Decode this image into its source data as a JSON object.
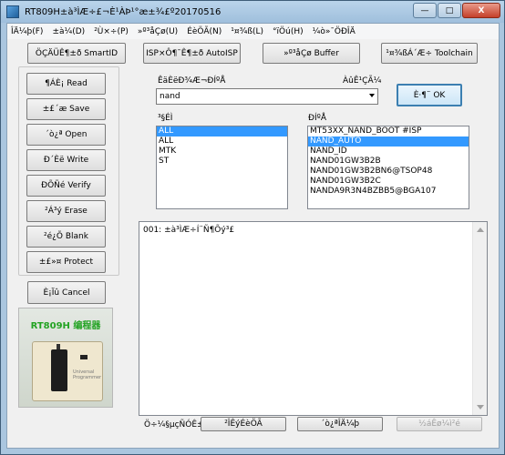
{
  "window": {
    "title": "RT809H±à³ÌÆ÷£¬È¹ÀÞ¹°æ±¾£º20170516",
    "minimize_glyph": "—",
    "maximize_glyph": "□",
    "close_glyph": "X"
  },
  "menu": [
    "ÎÄ¼þ(F)",
    "±à¼­(D)",
    "²Ù×÷(P)",
    "»º³åÇø(U)",
    "ÉèÖÃ(N)",
    "¹¤¾ß(L)",
    "°ïÖú(H)",
    "¼ò»¯ÖÐÎÄ"
  ],
  "toolbar": {
    "smartid": "ÖÇÄÜÊ¶±ð SmartID",
    "autoisp": "ISP×Ô¶¯Ê¶±ð AutoISP",
    "buffer": "»º³åÇø Buffer",
    "toolchain": "¹¤¾ßÁ´Æ÷ Toolchain"
  },
  "actions": [
    "¶ÁÈ¡ Read",
    "±£´æ Save",
    "´ò¿ª Open",
    "Ð´Èë Write",
    "ÐÕÑé Verify",
    "²Á³ý Erase",
    "²é¿Õ Blank",
    "±£»¤ Protect"
  ],
  "cancel_label": "È¡Ïû Cancel",
  "device_caption": "RT809H 编程器",
  "device_brand": "Universal Programmer",
  "search": {
    "label": "ÊäÈëÐ¾Æ¬ÐÍºÅ",
    "value": "nand",
    "count_label": "ÀûÊ¹ÇÃ¼",
    "ok_label": "È·¶¨ OK"
  },
  "manufacturers": {
    "label": "³§ÉÌ",
    "items": [
      "ALL",
      "ALL",
      "MTK",
      "ST"
    ],
    "selected": 0
  },
  "chips": {
    "label": "ÐÍºÅ",
    "items": [
      "MT53XX_NAND_BOOT #ISP",
      "NAND_AUTO",
      "NAND_ID",
      "NAND01GW3B2B",
      "NAND01GW3B2BN6@TSOP48",
      "NAND01GW3B2C",
      "NANDA9R3N4BZBB5@BGA107"
    ],
    "selected": 1
  },
  "log": {
    "lines": [
      "001:  ±à³ÌÆ÷Í¨Ñ¶Õý³£"
    ]
  },
  "bottom": {
    "status_label": "Ö÷¼§µçÑÓÊ±",
    "btn1": "²ÎÊýÉèÖÃ",
    "btn2": "´ò¿ªÎÄ¼þ",
    "btn3": "½áÊø¼ì²é"
  }
}
